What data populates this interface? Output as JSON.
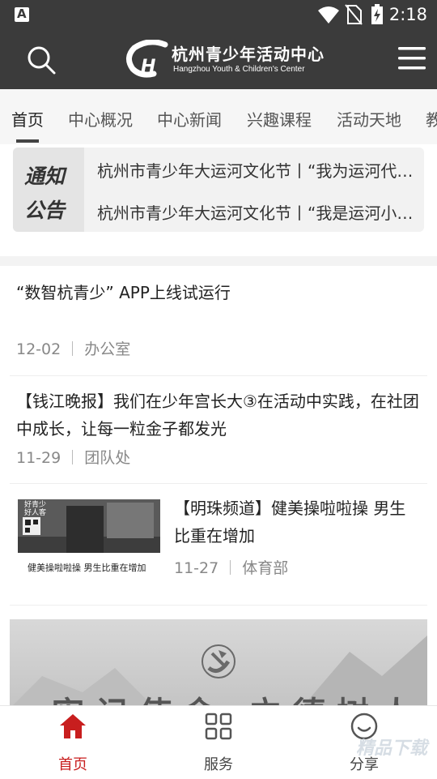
{
  "status_bar": {
    "time": "2:18",
    "icons": [
      "a-icon",
      "wifi-icon",
      "no-sim-icon",
      "battery-charging-icon"
    ]
  },
  "header": {
    "logo_cn": "杭州青少年活动中心",
    "logo_en": "Hangzhou Youth & Children's Center",
    "icons": [
      "search-icon",
      "menu-icon"
    ]
  },
  "tabs": [
    {
      "label": "首页",
      "active": true
    },
    {
      "label": "中心概况"
    },
    {
      "label": "中心新闻"
    },
    {
      "label": "兴趣课程"
    },
    {
      "label": "活动天地"
    },
    {
      "label": "教"
    }
  ],
  "notice": {
    "tag_line1": "通知",
    "tag_line2": "公告",
    "items": [
      "杭州市青少年大运河文化节丨“我为运河代言”",
      "杭州市青少年大运河文化节丨“我是运河小使者”"
    ]
  },
  "news": [
    {
      "title": "“数智杭青少” APP上线试运行",
      "date": "12-02",
      "dept": "办公室"
    },
    {
      "title": "【钱江晚报】我们在少年宫长大③在活动中实践，在社团中成长，让每一粒金子都发光",
      "date": "11-29",
      "dept": "团队处"
    },
    {
      "title": "【明珠频道】健美操啦啦操 男生比重在增加",
      "date": "11-27",
      "dept": "体育部",
      "thumb_caption": "健美操啦啦操 男生比重在增加",
      "thumb_sign": "好青少\n好人客"
    }
  ],
  "banner": {
    "text": "牢记使命 立德树人"
  },
  "bottom_nav": [
    {
      "label": "首页",
      "icon": "home-icon",
      "active": true
    },
    {
      "label": "服务",
      "icon": "grid-icon"
    },
    {
      "label": "分享",
      "icon": "smile-icon"
    }
  ],
  "colors": {
    "header_bg": "#3b3b3b",
    "accent": "#c81e1e",
    "tab_bg": "#f6f6f6"
  },
  "watermark": "精品下载"
}
